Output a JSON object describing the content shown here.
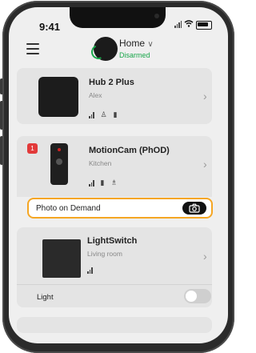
{
  "status_bar": {
    "time": "9:41"
  },
  "header": {
    "hub_name": "Home",
    "hub_chevron": "∨",
    "hub_status": "Disarmed",
    "status_color": "#19a64a"
  },
  "devices": [
    {
      "name": "Hub 2 Plus",
      "room": "Alex",
      "icons": [
        "signal-icon",
        "siren-icon",
        "battery-icon"
      ]
    },
    {
      "name": "MotionCam (PhOD)",
      "room": "Kitchen",
      "badge": "1",
      "icons": [
        "signal-icon",
        "battery-icon",
        "pet-immunity-icon"
      ]
    },
    {
      "name": "LightSwitch",
      "room": "Living room",
      "icons": [
        "signal-icon"
      ]
    }
  ],
  "photo_on_demand": {
    "label": "Photo on Demand"
  },
  "light_toggle": {
    "label": "Light",
    "state": "off"
  },
  "colors": {
    "highlight_border": "#f5a623",
    "badge": "#e23a3a"
  }
}
